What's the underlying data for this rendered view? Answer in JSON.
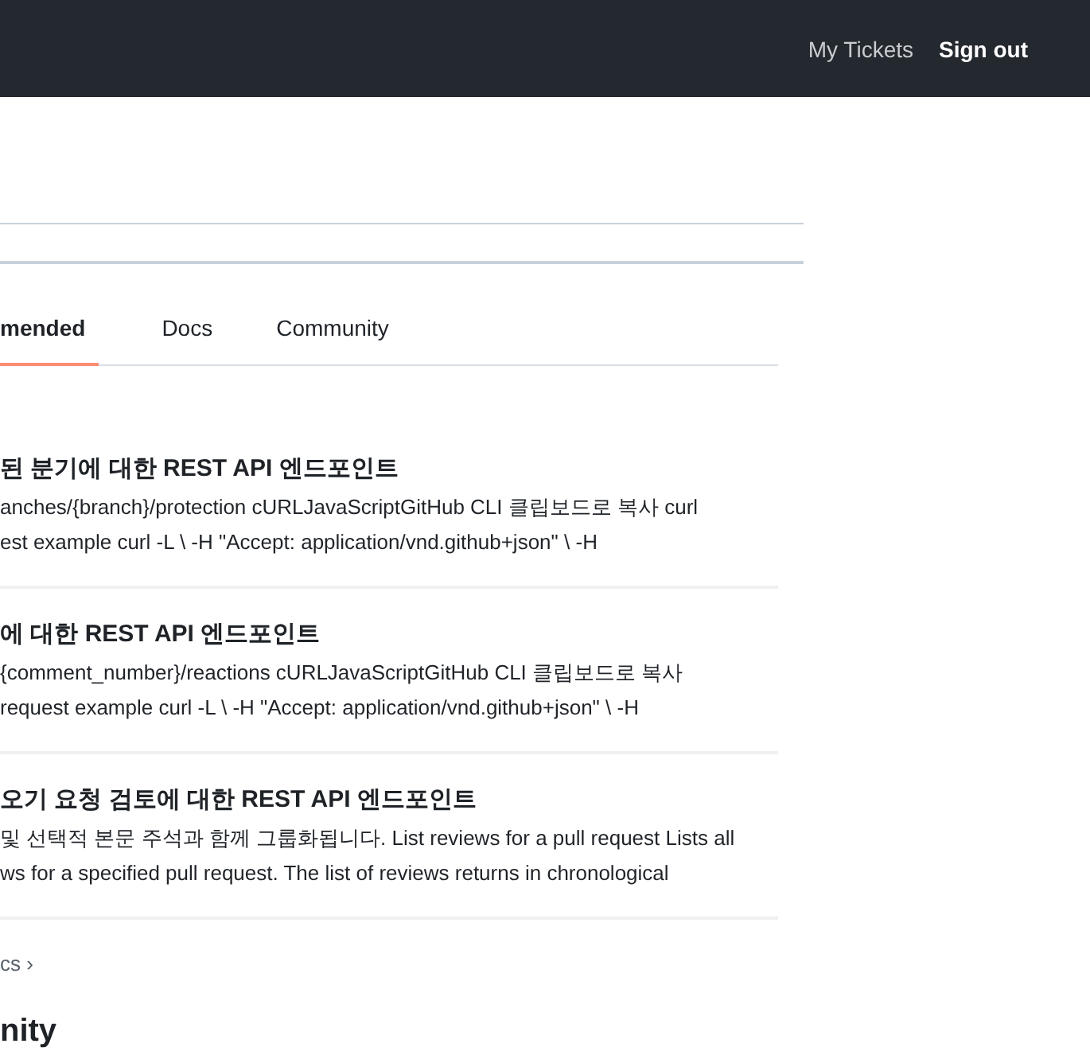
{
  "header": {
    "links": [
      {
        "label": "My Tickets",
        "kind": "muted"
      },
      {
        "label": "Sign out",
        "kind": "strong"
      }
    ]
  },
  "tabs": [
    {
      "label": "mended",
      "selected": true
    },
    {
      "label": "Docs",
      "selected": false
    },
    {
      "label": "Community",
      "selected": false
    }
  ],
  "results": [
    {
      "title": "된 분기에 대한 REST API 엔드포인트",
      "lines": [
        "anches/{branch}/protection cURLJavaScriptGitHub CLI 클립보드로 복사 curl",
        "est example curl -L \\ -H \"Accept: application/vnd.github+json\" \\ -H"
      ]
    },
    {
      "title": "에 대한 REST API 엔드포인트",
      "lines": [
        "{comment_number}/reactions cURLJavaScriptGitHub CLI 클립보드로 복사",
        "request example curl -L \\ -H \"Accept: application/vnd.github+json\" \\ -H"
      ]
    },
    {
      "title": "오기 요청 검토에 대한 REST API 엔드포인트",
      "lines": [
        "및 선택적 본문 주석과 함께 그룹화됩니다. List reviews for a pull request Lists all",
        "ws for a specified pull request. The list of reviews returns in chronological"
      ]
    }
  ],
  "more_link": {
    "label": "cs",
    "arrow": "›"
  },
  "section_heading": "nity"
}
